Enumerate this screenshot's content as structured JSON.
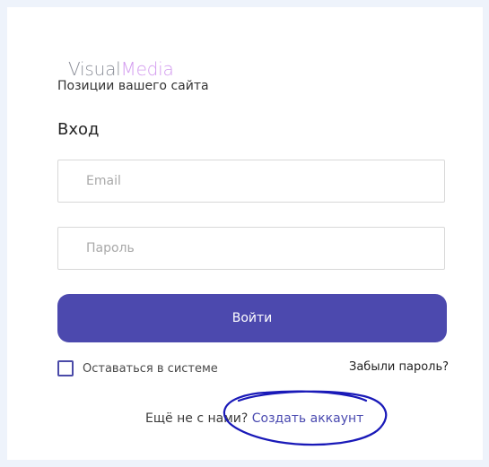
{
  "brand": {
    "visual": "Visual",
    "media": "Media",
    "tagline": "Позиции вашего сайта",
    "visual_color": "#8c8f99",
    "media_color": "#d39bef"
  },
  "login": {
    "title": "Вход",
    "email_placeholder": "Email",
    "password_placeholder": "Пароль",
    "submit_label": "Войти",
    "remember_label": "Оставаться в системе",
    "remember_checked": false,
    "forgot_label": "Забыли пароль?"
  },
  "signup": {
    "prompt": "Ещё не с нами? ",
    "link_label": "Создать аккаунт"
  },
  "colors": {
    "page_background": "#eef3fb",
    "card_background": "#ffffff",
    "primary_button": "#4c49ae",
    "link": "#4a4ab0",
    "annotation": "#1919b8"
  },
  "annotation": {
    "icon": "hand-drawn-circle"
  }
}
